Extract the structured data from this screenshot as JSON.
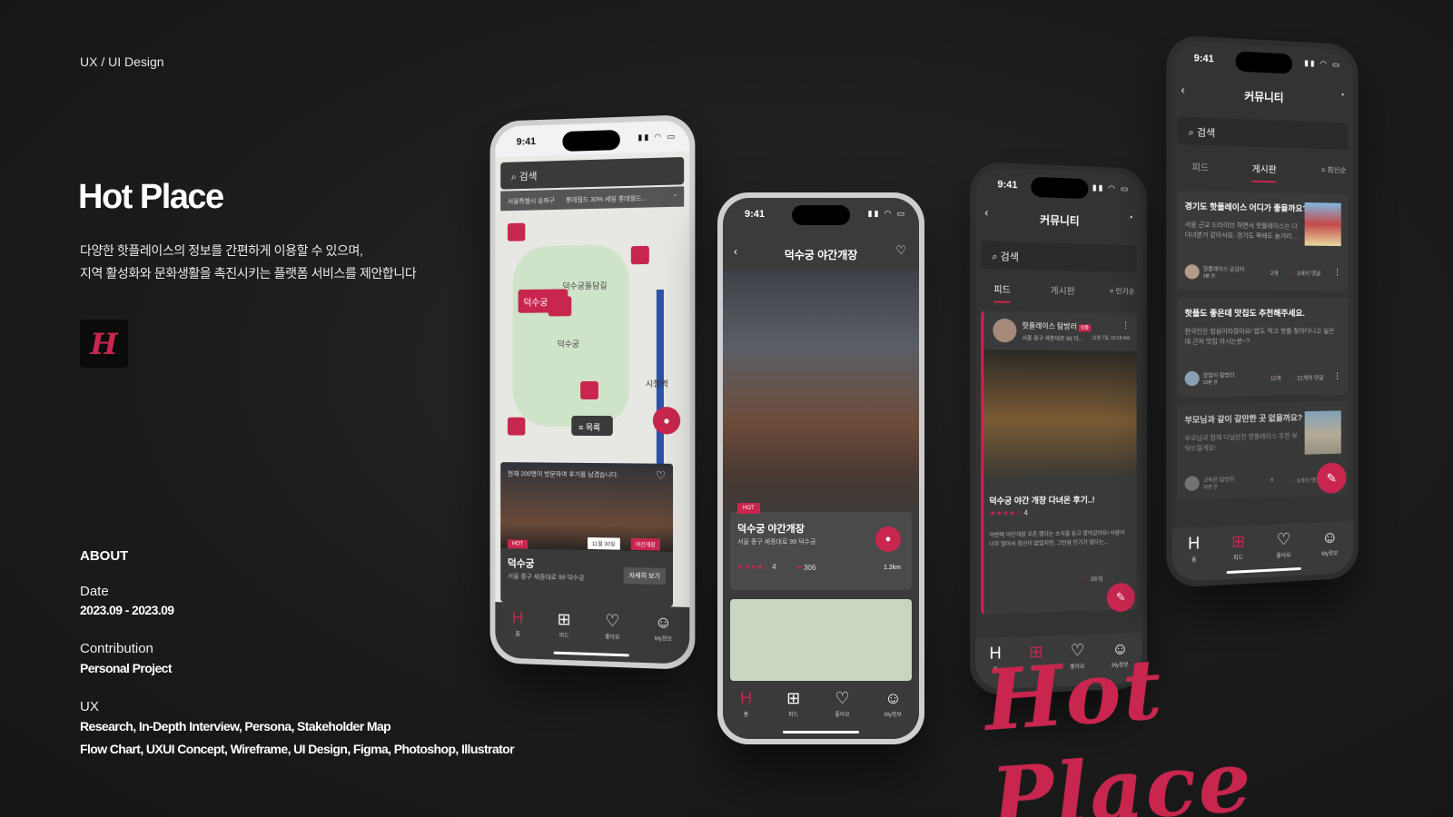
{
  "eyebrow": "UX / UI Design",
  "title": "Hot Place",
  "description": [
    "다양한 핫플레이스의 정보를 간편하게 이용할 수 있으며,",
    "지역 활성화와 문화생활을 촉진시키는 플랫폼 서비스를 제안합니다"
  ],
  "logo_glyph": "H",
  "about": {
    "heading": "ABOUT",
    "date_label": "Date",
    "date_value": "2023.09 - 2023.09",
    "contribution_label": "Contribution",
    "contribution_value": "Personal Project",
    "ux_label": "UX",
    "ux_line1": "Research, In-Depth Interview, Persona, Stakeholder Map",
    "ux_line2": "Flow Chart, UXUI Concept, Wireframe, UI Design, Figma, Photoshop, Illustrator"
  },
  "colors": {
    "accent": "#c8264f",
    "background": "#1c1c1c"
  },
  "status_time": "9:41",
  "tabs": [
    "홈",
    "피드",
    "좋아요",
    "My정보"
  ],
  "phone1": {
    "search": "검색",
    "location": "서울특별시 송파구",
    "promo": "롯데월드 30% 세일 롯데월드...",
    "map_labels": [
      "덕수궁",
      "덕수궁돌담길",
      "시청역",
      "덕수궁"
    ],
    "list_button": "목록",
    "card_notice": "현재 200명이 방문하여 후기를 남겼습니다.",
    "card_badge": "HOT",
    "card_date": "11월 30일",
    "card_tag": "야간개장",
    "card_title": "덕수궁",
    "card_address": "서울 중구 세종대로 99 덕수궁",
    "card_button": "자세히 보기"
  },
  "phone2": {
    "header": "덕수궁 야간개장",
    "badge": "HOT",
    "title": "덕수궁 야간개장",
    "address": "서울 중구 세종대로 99 덕수궁",
    "rating": "4",
    "likes": "306",
    "distance": "1.2km"
  },
  "phone3": {
    "header": "커뮤니티",
    "search": "검색",
    "tab_feed": "피드",
    "tab_board": "게시판",
    "sort": "인기순",
    "author": "핫플레이스 탐방러",
    "author_badge": "인증",
    "post_address": "서울 중구 세종대로 99 덕...",
    "post_time": "11월 7일, 10:18 AM",
    "post_title": "덕수궁 야간 개장 다녀온 후기..!",
    "post_rating": "4",
    "post_body": "이번에 야간개장 오픈 했다는 소식을 듣고 찾아갔어요! 사람이 너무 많아서 정신이 없었지만, 그만큼 인기가 많다는...",
    "post_likes": "38개"
  },
  "phone4": {
    "header": "커뮤니티",
    "search": "검색",
    "tab_feed": "피드",
    "tab_board": "게시판",
    "sort": "최신순",
    "posts": [
      {
        "title": "경기도 핫플레이스 어디가 좋을까요?",
        "body": "서울 근교 드라이브 하면서 핫플레이스는 다 다녀본거 같아서요. 경기도 쪽에도 놀거리...",
        "author": "핫플레이스 궁금러",
        "time": "3분 전",
        "likes": "2개",
        "comments": "3개의 댓글"
      },
      {
        "title": "핫플도 좋은데 맛집도 추천해주세요.",
        "body": "한국인은 밥심이라잖아요! 밥도 먹고 핫플 찾아다니고 싶은데 근처 맛집 아시는분~?",
        "author": "맛집이 탐방러",
        "time": "10분 전",
        "likes": "12개",
        "comments": "21개의 댓글"
      },
      {
        "title": "부모님과 같이 갈만한 곳 없을까요?",
        "body": "부모님과 함께 다닐만한 핫플레이스 추천 부탁드릴게요!",
        "author": "고독한 탐방러",
        "time": "30분 전",
        "likes": "8",
        "comments": "5개의 댓글"
      }
    ]
  },
  "script_title": "Hot Place"
}
